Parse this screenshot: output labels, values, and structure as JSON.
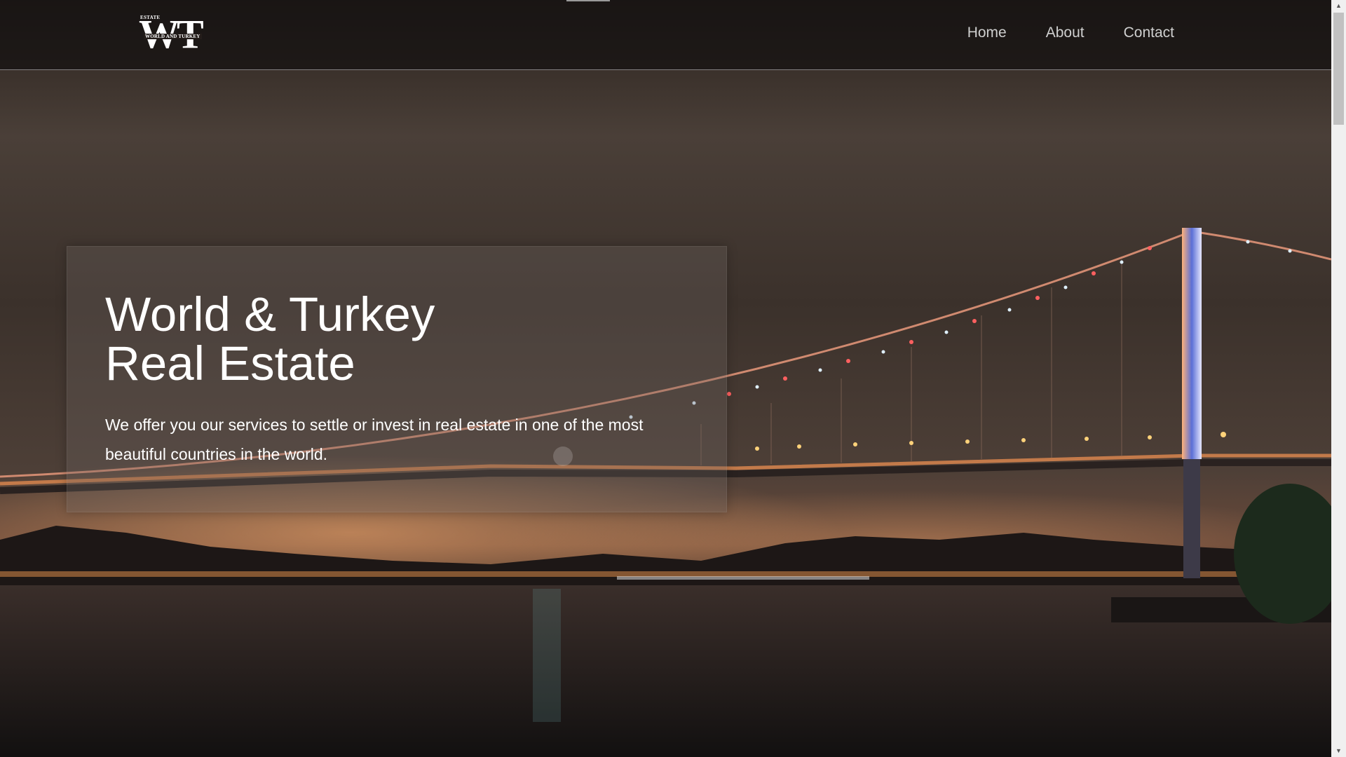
{
  "logo": {
    "estate": "ESTATE",
    "letters": "WT",
    "subtitle": "WORLD AND TURKEY"
  },
  "nav": {
    "items": [
      {
        "label": "Home"
      },
      {
        "label": "About"
      },
      {
        "label": "Contact"
      }
    ]
  },
  "hero": {
    "title_line1": "World & Turkey",
    "title_line2": "Real Estate",
    "description": "We offer you our services to settle or invest in real estate in one of the most beautiful countries in the world."
  },
  "scrollbar": {
    "up_icon": "scroll-up-arrow-icon",
    "down_icon": "scroll-down-arrow-icon"
  }
}
